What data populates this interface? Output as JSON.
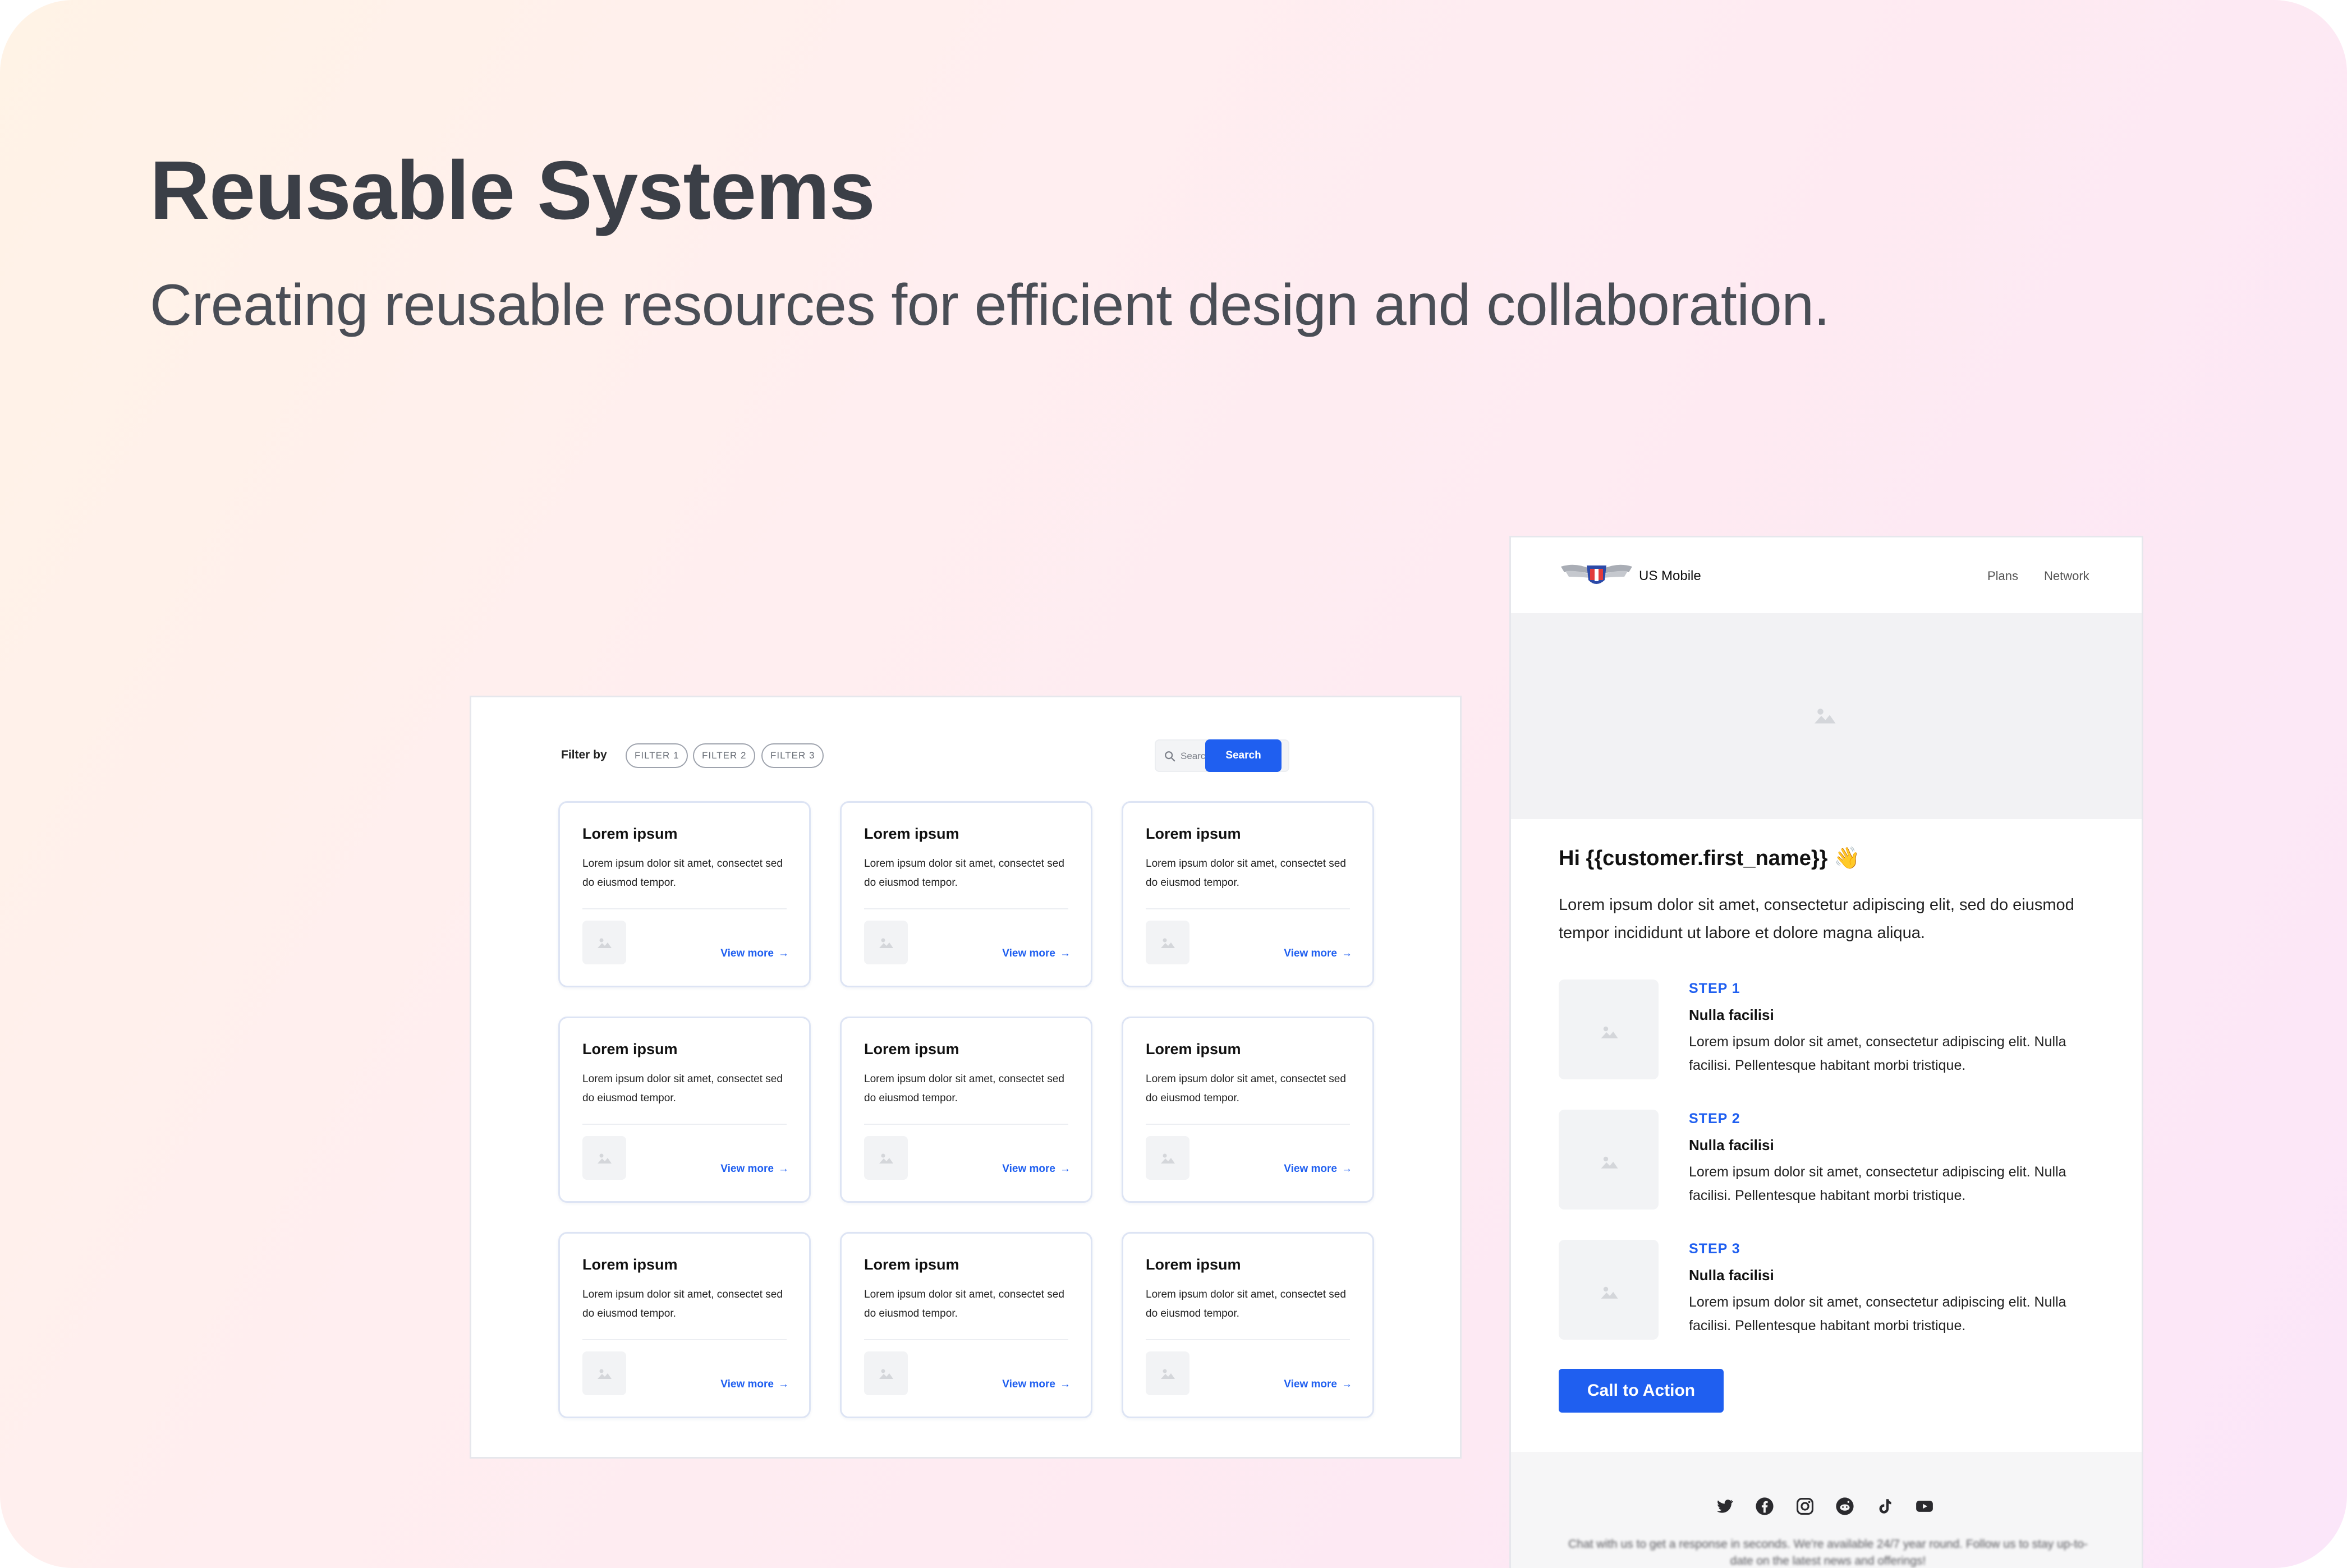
{
  "hero": {
    "title": "Reusable Systems",
    "subtitle": "Creating reusable resources for efficient design and collaboration."
  },
  "grid_panel": {
    "filter_label": "Filter by",
    "filters": [
      "FILTER 1",
      "FILTER 2",
      "FILTER 3"
    ],
    "search_placeholder": "Search here",
    "search_button": "Search",
    "cards": [
      {
        "title": "Lorem ipsum",
        "body": "Lorem ipsum dolor sit amet, consectet sed do eiusmod tempor.",
        "link": "View more"
      },
      {
        "title": "Lorem ipsum",
        "body": "Lorem ipsum dolor sit amet, consectet sed do eiusmod tempor.",
        "link": "View more"
      },
      {
        "title": "Lorem ipsum",
        "body": "Lorem ipsum dolor sit amet, consectet sed do eiusmod tempor.",
        "link": "View more"
      },
      {
        "title": "Lorem ipsum",
        "body": "Lorem ipsum dolor sit amet, consectet sed do eiusmod tempor.",
        "link": "View more"
      },
      {
        "title": "Lorem ipsum",
        "body": "Lorem ipsum dolor sit amet, consectet sed do eiusmod tempor.",
        "link": "View more"
      },
      {
        "title": "Lorem ipsum",
        "body": "Lorem ipsum dolor sit amet, consectet sed do eiusmod tempor.",
        "link": "View more"
      },
      {
        "title": "Lorem ipsum",
        "body": "Lorem ipsum dolor sit amet, consectet sed do eiusmod tempor.",
        "link": "View more"
      },
      {
        "title": "Lorem ipsum",
        "body": "Lorem ipsum dolor sit amet, consectet sed do eiusmod tempor.",
        "link": "View more"
      },
      {
        "title": "Lorem ipsum",
        "body": "Lorem ipsum dolor sit amet, consectet sed do eiusmod tempor.",
        "link": "View more"
      }
    ]
  },
  "email": {
    "brand": "US Mobile",
    "nav": {
      "plans": "Plans",
      "network": "Network"
    },
    "greeting": "Hi {{customer.first_name}} 👋",
    "intro": "Lorem ipsum dolor sit amet, consectetur adipiscing elit, sed do eiusmod tempor incididunt ut labore et dolore magna aliqua.",
    "steps": [
      {
        "label": "STEP 1",
        "heading": "Nulla facilisi",
        "body": "Lorem ipsum dolor sit amet, consectetur adipiscing elit. Nulla facilisi. Pellentesque habitant morbi tristique."
      },
      {
        "label": "STEP 2",
        "heading": "Nulla facilisi",
        "body": "Lorem ipsum dolor sit amet, consectetur adipiscing elit. Nulla facilisi. Pellentesque habitant morbi tristique."
      },
      {
        "label": "STEP 3",
        "heading": "Nulla facilisi",
        "body": "Lorem ipsum dolor sit amet, consectetur adipiscing elit. Nulla facilisi. Pellentesque habitant morbi tristique."
      }
    ],
    "cta": "Call to Action",
    "social_icons": [
      "twitter-icon",
      "facebook-icon",
      "instagram-icon",
      "reddit-icon",
      "tiktok-icon",
      "youtube-icon"
    ],
    "footer_text": "Chat with us to get a response in seconds. We're available 24/7 year round. Follow us to stay up-to-date on the latest news and offerings!"
  },
  "colors": {
    "accent": "#1f5ff0",
    "title_text": "#3b3f47",
    "card_border": "#dde4f4",
    "placeholder_fill": "#f2f3f5"
  }
}
